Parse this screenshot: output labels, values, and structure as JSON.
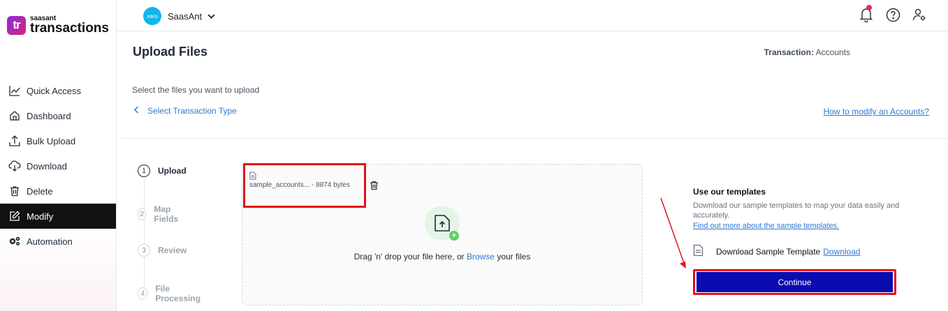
{
  "brand": {
    "small": "saasant",
    "big": "transactions",
    "mark": "tr"
  },
  "sidebar": {
    "items": [
      {
        "label": "Quick Access",
        "icon": "chart-line-icon"
      },
      {
        "label": "Dashboard",
        "icon": "home-icon"
      },
      {
        "label": "Bulk Upload",
        "icon": "upload-icon"
      },
      {
        "label": "Download",
        "icon": "cloud-download-icon"
      },
      {
        "label": "Delete",
        "icon": "trash-icon"
      },
      {
        "label": "Modify",
        "icon": "edit-icon",
        "active": true
      },
      {
        "label": "Automation",
        "icon": "gears-icon"
      }
    ]
  },
  "topbar": {
    "org_name": "SaasAnt",
    "org_logo_text": "xero"
  },
  "main": {
    "title": "Upload Files",
    "transaction_label": "Transaction:",
    "transaction_value": "Accounts",
    "select_hint": "Select the files you want to upload",
    "back_link": "Select Transaction Type",
    "howto_link": "How to modify an Accounts?"
  },
  "steps": [
    {
      "num": "1",
      "label": "Upload",
      "active": true
    },
    {
      "num": "2",
      "label": "Map Fields"
    },
    {
      "num": "3",
      "label": "Review"
    },
    {
      "num": "4",
      "label": "File Processing"
    }
  ],
  "upload": {
    "file_name": "sample_accounts... - 8874 bytes",
    "drop_prefix": "Drag 'n' drop your file here, or ",
    "browse": "Browse",
    "drop_suffix": " your files",
    "plus": "+"
  },
  "templates": {
    "title": "Use our templates",
    "desc": "Download our sample templates to map your data easily and accurately.",
    "link": "Find out more about the sample templates.",
    "download_label": "Download Sample Template",
    "download_link": "Download",
    "continue": "Continue"
  },
  "colors": {
    "accent": "#2a7bd4",
    "continue_bg": "#0b0bb0",
    "highlight": "#e3101a",
    "active_nav": "#111111"
  }
}
